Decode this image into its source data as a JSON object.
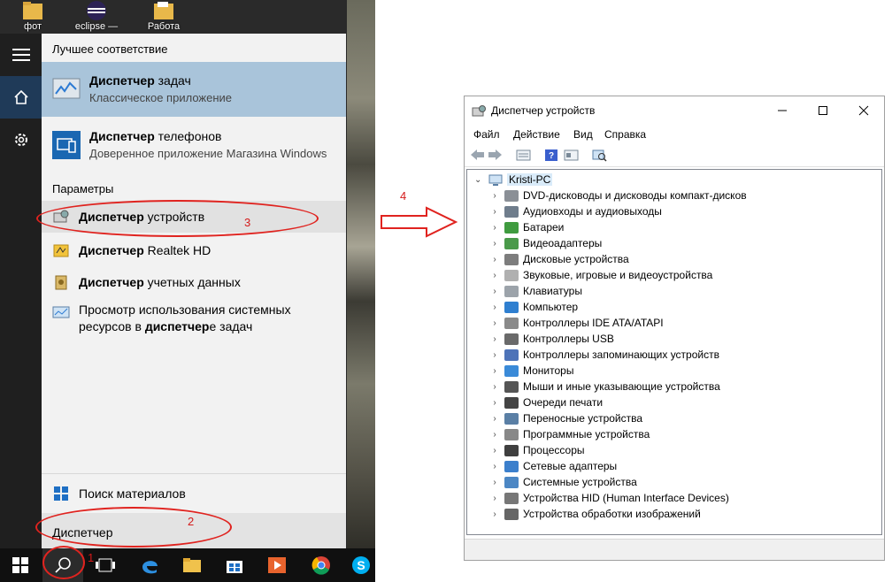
{
  "desktop": {
    "icons": [
      {
        "label": "фот",
        "icon": "folder-icon"
      },
      {
        "label": "eclipse —",
        "icon": "eclipse-icon"
      },
      {
        "label": "Работа",
        "icon": "folder-icon"
      }
    ]
  },
  "start": {
    "best_match_header": "Лучшее соответствие",
    "best_match": {
      "title_bold": "Диспетчер",
      "title_rest": " задач",
      "subtitle": "Классическое приложение"
    },
    "phones": {
      "title_bold": "Диспетчер",
      "title_rest": " телефонов",
      "subtitle": "Доверенное приложение Магазина Windows"
    },
    "settings_header": "Параметры",
    "settings": [
      {
        "bold": "Диспетчер",
        "rest": " устройств"
      },
      {
        "bold": "Диспетчер",
        "rest": " Realtek HD"
      },
      {
        "bold": "Диспетчер",
        "rest": " учетных данных"
      }
    ],
    "resource_line1": "Просмотр использования системных",
    "resource_line2_pre": "ресурсов в ",
    "resource_line2_bold": "диспетчер",
    "resource_line2_post": "е задач",
    "store_search": "Поиск материалов",
    "search_value": "Диспетчер"
  },
  "annotations": {
    "n1": "1",
    "n2": "2",
    "n3": "3",
    "n4": "4"
  },
  "devmgr": {
    "title": "Диспетчер устройств",
    "menu": [
      "Файл",
      "Действие",
      "Вид",
      "Справка"
    ],
    "root": "Kristi-PC",
    "categories": [
      "DVD-дисководы и дисководы компакт-дисков",
      "Аудиовходы и аудиовыходы",
      "Батареи",
      "Видеоадаптеры",
      "Дисковые устройства",
      "Звуковые, игровые и видеоустройства",
      "Клавиатуры",
      "Компьютер",
      "Контроллеры IDE ATA/ATAPI",
      "Контроллеры USB",
      "Контроллеры запоминающих устройств",
      "Мониторы",
      "Мыши и иные указывающие устройства",
      "Очереди печати",
      "Переносные устройства",
      "Программные устройства",
      "Процессоры",
      "Сетевые адаптеры",
      "Системные устройства",
      "Устройства HID (Human Interface Devices)",
      "Устройства обработки изображений"
    ]
  },
  "colors": {
    "accent": "#0078d7",
    "highlight": "#a9c4da",
    "annotation": "#e0231f"
  }
}
